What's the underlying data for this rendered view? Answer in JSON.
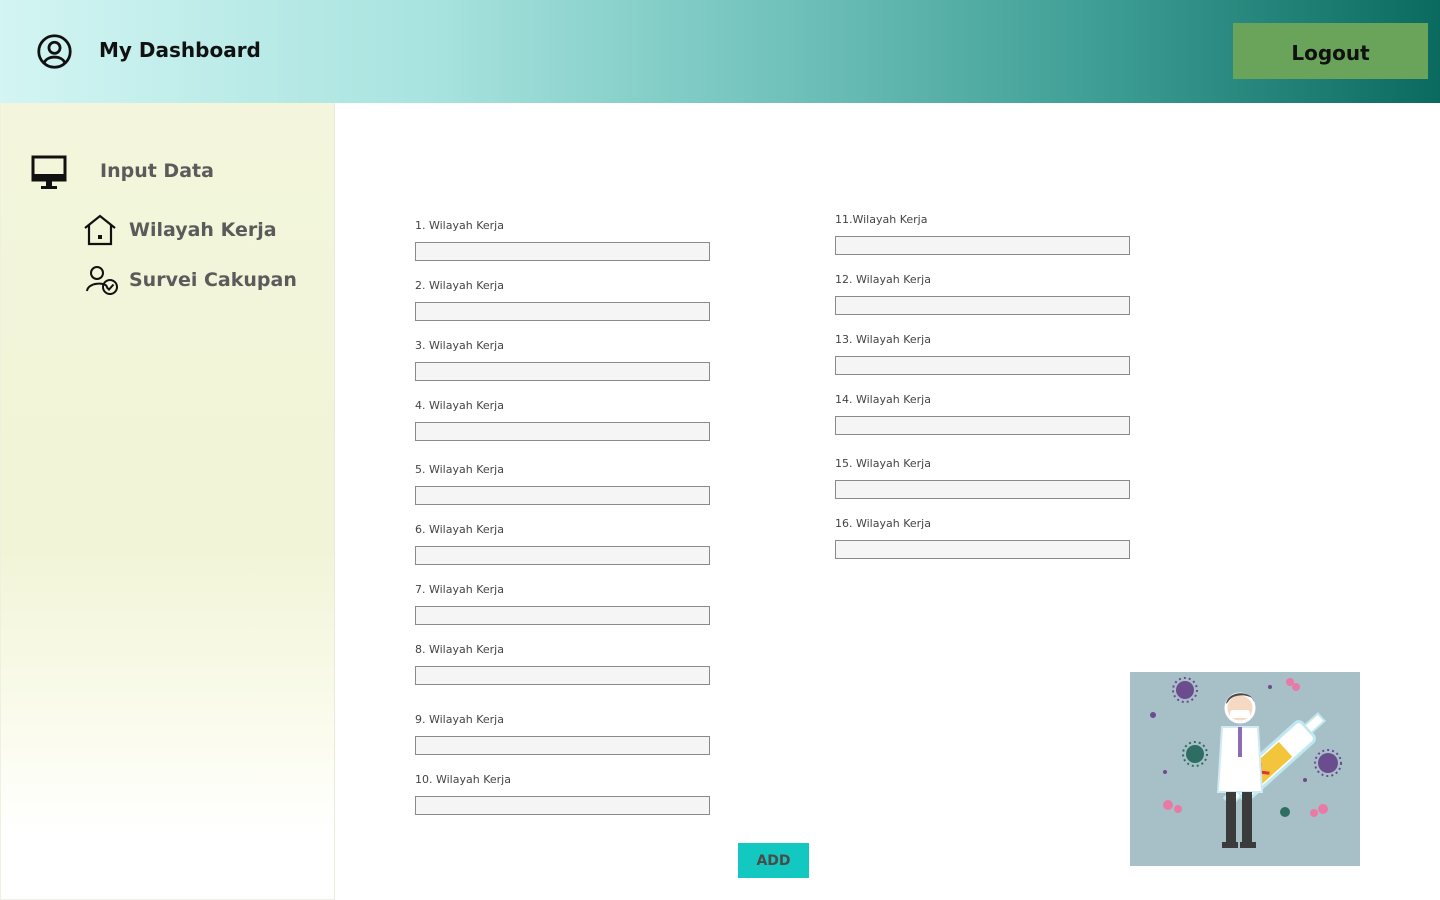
{
  "header": {
    "title": "My Dashboard",
    "logout_label": "Logout"
  },
  "sidebar": {
    "section_title": "Input Data",
    "items": [
      {
        "label": "Wilayah Kerja",
        "icon": "home-icon"
      },
      {
        "label": "Survei Cakupan",
        "icon": "user-check-icon"
      }
    ]
  },
  "form": {
    "fields": [
      {
        "label": "1. Wilayah Kerja",
        "value": ""
      },
      {
        "label": "2. Wilayah Kerja",
        "value": ""
      },
      {
        "label": "3. Wilayah Kerja",
        "value": ""
      },
      {
        "label": "4. Wilayah Kerja",
        "value": ""
      },
      {
        "label": "5. Wilayah Kerja",
        "value": ""
      },
      {
        "label": "6. Wilayah Kerja",
        "value": ""
      },
      {
        "label": "7. Wilayah Kerja",
        "value": ""
      },
      {
        "label": "8. Wilayah Kerja",
        "value": ""
      },
      {
        "label": "9. Wilayah Kerja",
        "value": ""
      },
      {
        "label": "10. Wilayah Kerja",
        "value": ""
      },
      {
        "label": "11.Wilayah Kerja",
        "value": ""
      },
      {
        "label": "12. Wilayah Kerja",
        "value": ""
      },
      {
        "label": "13. Wilayah Kerja",
        "value": ""
      },
      {
        "label": "14. Wilayah Kerja",
        "value": ""
      },
      {
        "label": "15. Wilayah Kerja",
        "value": ""
      },
      {
        "label": "16. Wilayah Kerja",
        "value": ""
      }
    ],
    "add_label": "ADD"
  },
  "colors": {
    "accent": "#12c8c0",
    "logout": "#6aa35a",
    "header_start": "#d3f5f3",
    "header_end": "#0b6a60",
    "sidebar_bg": "#f3f6dc"
  },
  "illustration": {
    "icon": "doctor-vaccine-illustration"
  }
}
